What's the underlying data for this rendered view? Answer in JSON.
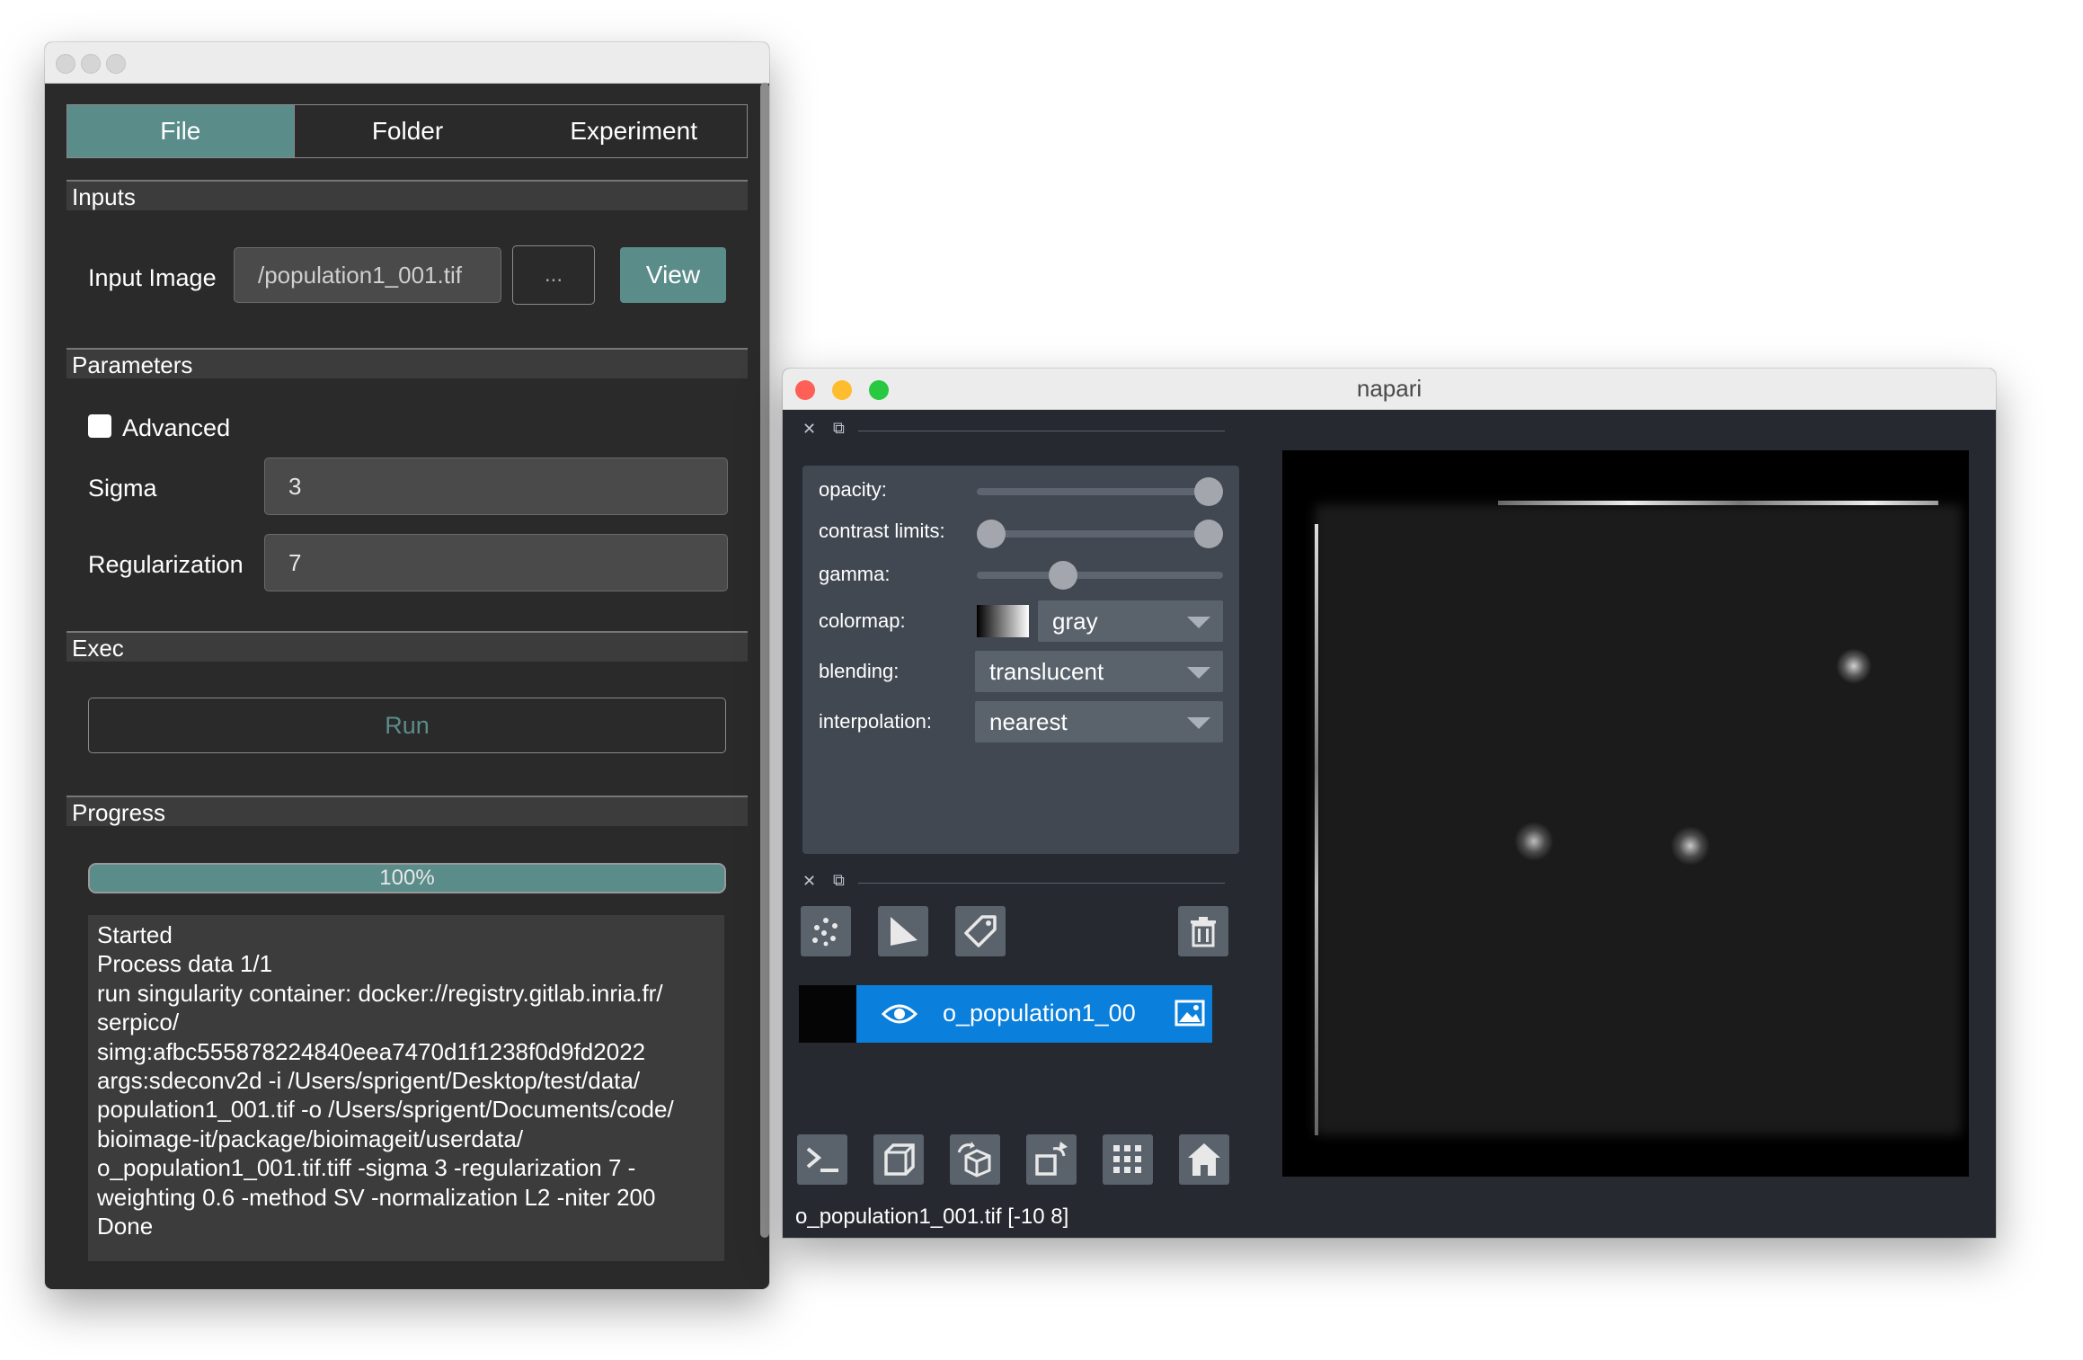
{
  "left_window": {
    "tabs": [
      {
        "label": "File",
        "active": true
      },
      {
        "label": "Folder",
        "active": false
      },
      {
        "label": "Experiment",
        "active": false
      }
    ],
    "sections": {
      "inputs": "Inputs",
      "parameters": "Parameters",
      "exec": "Exec",
      "progress": "Progress"
    },
    "input_image_label": "Input Image",
    "input_image_value": "/population1_001.tif",
    "browse_label": "...",
    "view_label": "View",
    "advanced_label": "Advanced",
    "advanced_checked": false,
    "sigma_label": "Sigma",
    "sigma_value": "3",
    "regularization_label": "Regularization",
    "regularization_value": "7",
    "run_label": "Run",
    "progress_percent": 100,
    "progress_text": "100%",
    "log_text": "Started\nProcess data 1/1\nrun singularity container: docker://registry.gitlab.inria.fr/\nserpico/\nsimg:afbc555878224840eea7470d1f1238f0d9fd2022\nargs:sdeconv2d -i /Users/sprigent/Desktop/test/data/\npopulation1_001.tif -o /Users/sprigent/Documents/code/\nbioimage-it/package/bioimageit/userdata/\no_population1_001.tif.tiff -sigma 3 -regularization 7 -\nweighting 0.6 -method SV -normalization L2 -niter 200\nDone"
  },
  "napari_window": {
    "title": "napari",
    "traffic_colors": {
      "close": "#fe5f57",
      "minimize": "#febc2e",
      "maximize": "#28c840"
    },
    "accent_color": "#0a7fdb",
    "controls": {
      "opacity_label": "opacity:",
      "opacity_value": 1.0,
      "contrast_label": "contrast limits:",
      "contrast_range": [
        0.0,
        1.0
      ],
      "gamma_label": "gamma:",
      "gamma_value": 0.33,
      "colormap_label": "colormap:",
      "colormap_value": "gray",
      "blending_label": "blending:",
      "blending_value": "translucent",
      "interpolation_label": "interpolation:",
      "interpolation_value": "nearest"
    },
    "layer_buttons": [
      "new-points-icon",
      "new-shapes-icon",
      "new-labels-icon",
      "delete-layer-icon"
    ],
    "layer": {
      "name": "o_population1_00",
      "visible": true
    },
    "viewer_buttons": [
      "console-icon",
      "ndisplay-toggle-icon",
      "roll-dims-icon",
      "transpose-icon",
      "grid-icon",
      "home-icon"
    ],
    "status_text": "o_population1_001.tif [-10   8]"
  }
}
